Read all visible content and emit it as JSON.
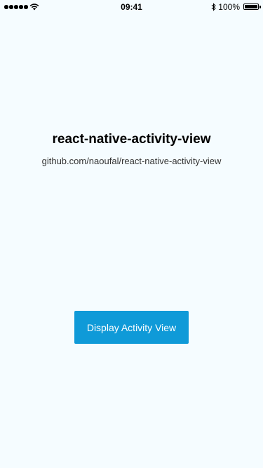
{
  "status_bar": {
    "time": "09:41",
    "battery_percent": "100%",
    "signal_bars": 5
  },
  "main": {
    "title": "react-native-activity-view",
    "subtitle": "github.com/naoufal/react-native-activity-view",
    "button_label": "Display Activity View"
  },
  "colors": {
    "background": "#f5fcff",
    "button": "#0f9ad8",
    "button_text": "#ffffff"
  }
}
